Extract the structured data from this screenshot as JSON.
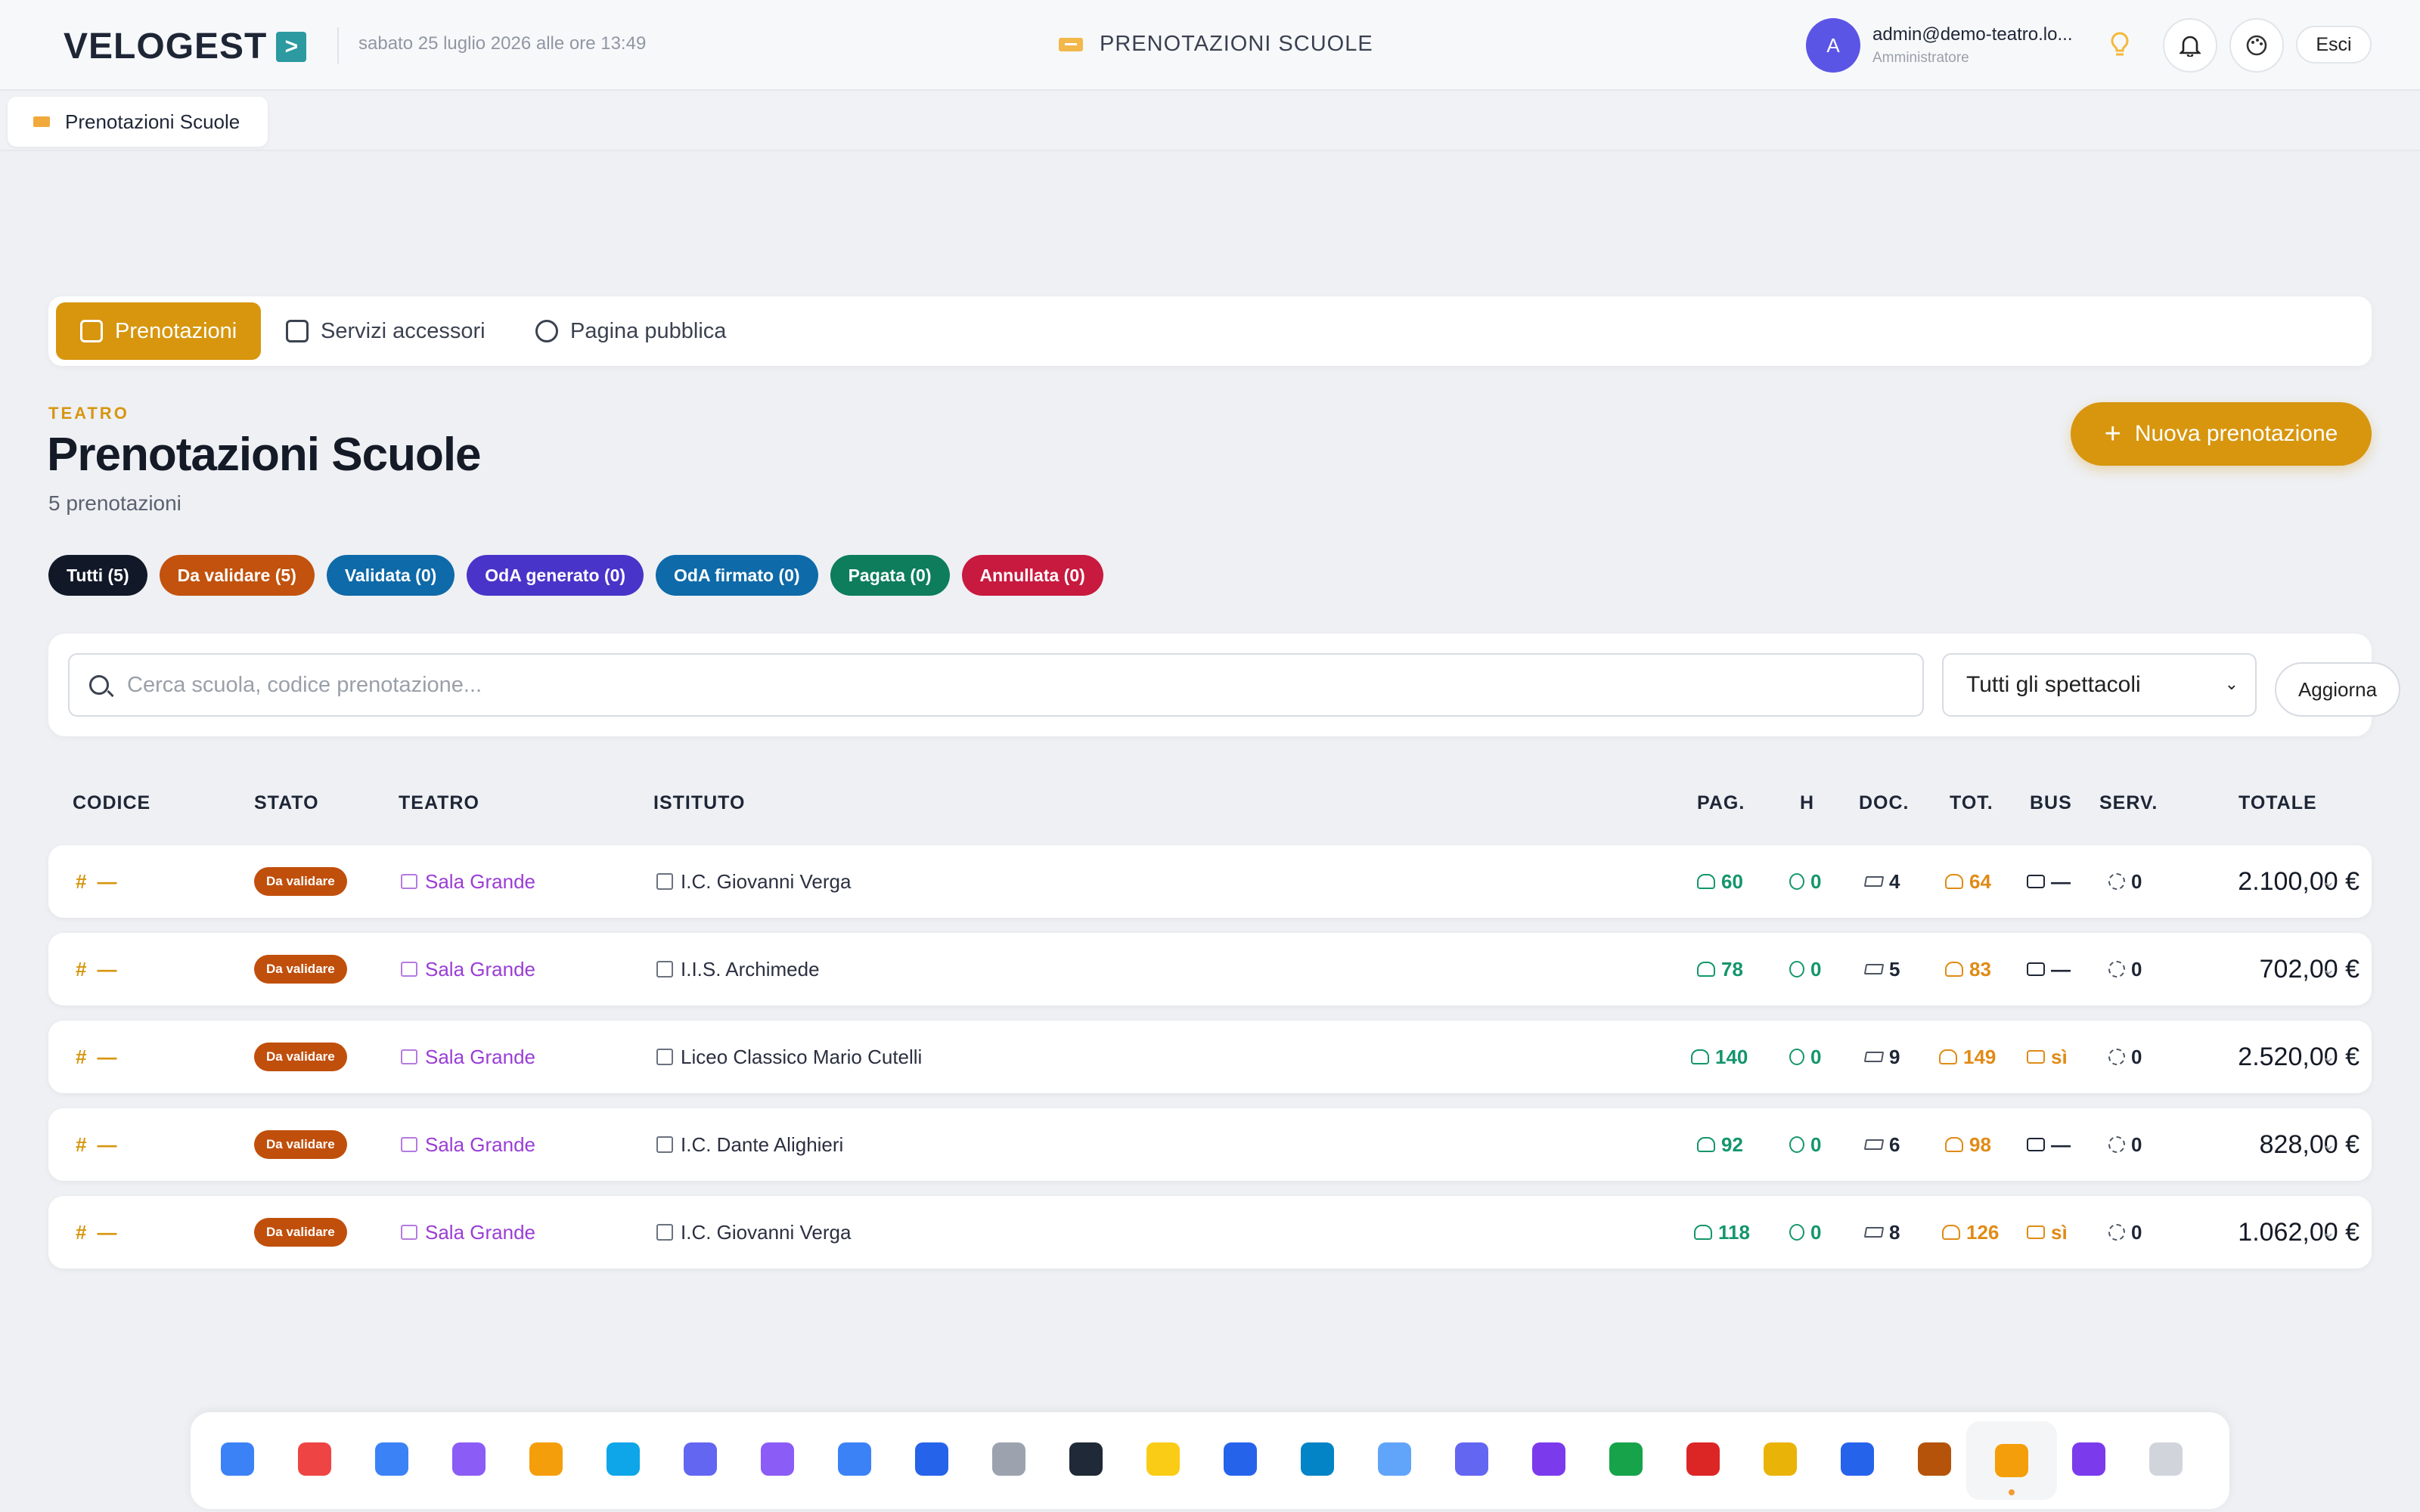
{
  "header": {
    "logo": "VELOGEST",
    "logo_mark": ">",
    "date": "sabato 25 luglio 2026 alle ore 13:49",
    "title": "PRENOTAZIONI SCUOLE",
    "user_initial": "A",
    "user_email": "admin@demo-teatro.lo...",
    "user_role": "Amministratore",
    "logout_label": "Esci",
    "icons": [
      "lightbulb-icon",
      "bell-icon",
      "palette-icon"
    ]
  },
  "page_tab": {
    "label": "Prenotazioni Scuole"
  },
  "tabs": [
    {
      "label": "Prenotazioni",
      "icon": "calendar-icon",
      "active": true
    },
    {
      "label": "Servizi accessori",
      "icon": "package-icon",
      "active": false
    },
    {
      "label": "Pagina pubblica",
      "icon": "globe-icon",
      "active": false
    }
  ],
  "section": {
    "kicker": "TEATRO",
    "title": "Prenotazioni Scuole",
    "count": "5 prenotazioni",
    "new_button": "Nuova prenotazione",
    "new_button_icon": "+"
  },
  "filters": [
    {
      "label": "Tutti (5)",
      "color": "#111827"
    },
    {
      "label": "Da validare (5)",
      "color": "#c2520d"
    },
    {
      "label": "Validata (0)",
      "color": "#0e6aa8"
    },
    {
      "label": "OdA generato (0)",
      "color": "#4834c9"
    },
    {
      "label": "OdA firmato (0)",
      "color": "#0e6aa8"
    },
    {
      "label": "Pagata (0)",
      "color": "#0d7d5c"
    },
    {
      "label": "Annullata (0)",
      "color": "#c8193f"
    }
  ],
  "search": {
    "placeholder": "Cerca scuola, codice prenotazione...",
    "select_value": "Tutti gli spettacoli",
    "select_caret": "⌄",
    "refresh_label": "Aggiorna"
  },
  "table": {
    "columns": [
      "CODICE",
      "STATO",
      "TEATRO",
      "ISTITUTO",
      "PAG.",
      "H",
      "DOC.",
      "TOT.",
      "BUS",
      "SERV.",
      "TOTALE"
    ],
    "rows": [
      {
        "hash": "#",
        "code": "—",
        "status": "Da validare",
        "theatre": "Sala Grande",
        "school": "I.C. Giovanni Verga",
        "pag": "60",
        "h": "0",
        "doc": "4",
        "tot": "64",
        "bus": "—",
        "serv": "0",
        "total": "2.100,00 €",
        "chevron": "⌄"
      },
      {
        "hash": "#",
        "code": "—",
        "status": "Da validare",
        "theatre": "Sala Grande",
        "school": "I.I.S. Archimede",
        "pag": "78",
        "h": "0",
        "doc": "5",
        "tot": "83",
        "bus": "—",
        "serv": "0",
        "total": "702,00 €",
        "chevron": "⌄"
      },
      {
        "hash": "#",
        "code": "—",
        "status": "Da validare",
        "theatre": "Sala Grande",
        "school": "Liceo Classico Mario Cutelli",
        "pag": "140",
        "h": "0",
        "doc": "9",
        "tot": "149",
        "bus": "sì",
        "serv": "0",
        "total": "2.520,00 €",
        "chevron": "⌄"
      },
      {
        "hash": "#",
        "code": "—",
        "status": "Da validare",
        "theatre": "Sala Grande",
        "school": "I.C. Dante Alighieri",
        "pag": "92",
        "h": "0",
        "doc": "6",
        "tot": "98",
        "bus": "—",
        "serv": "0",
        "total": "828,00 €",
        "chevron": "⌄"
      },
      {
        "hash": "#",
        "code": "—",
        "status": "Da validare",
        "theatre": "Sala Grande",
        "school": "I.C. Giovanni Verga",
        "pag": "118",
        "h": "0",
        "doc": "8",
        "tot": "126",
        "bus": "sì",
        "serv": "0",
        "total": "1.062,00 €",
        "chevron": "⌄"
      }
    ]
  },
  "dock": [
    {
      "icon": "apps-grid-icon",
      "color": "#3b82f6"
    },
    {
      "icon": "calendar-icon",
      "color": "#ef4444"
    },
    {
      "icon": "users-icon",
      "color": "#3b82f6"
    },
    {
      "icon": "network-icon",
      "color": "#8b5cf6"
    },
    {
      "icon": "package-icon",
      "color": "#f59e0b"
    },
    {
      "icon": "handshake-icon",
      "color": "#0ea5e9"
    },
    {
      "icon": "id-card-icon",
      "color": "#6366f1"
    },
    {
      "icon": "calculator-icon",
      "color": "#8b5cf6"
    },
    {
      "icon": "kanban-icon",
      "color": "#3b82f6"
    },
    {
      "icon": "headset-icon",
      "color": "#2563eb"
    },
    {
      "icon": "trash-icon",
      "color": "#9ca3af"
    },
    {
      "icon": "terminal-icon",
      "color": "#1f2937"
    },
    {
      "icon": "star-icon",
      "color": "#facc15"
    },
    {
      "icon": "building-icon",
      "color": "#2563eb"
    },
    {
      "icon": "globe-icon",
      "color": "#0284c7"
    },
    {
      "icon": "mail-icon",
      "color": "#60a5fa"
    },
    {
      "icon": "user-settings-icon",
      "color": "#6366f1"
    },
    {
      "icon": "video-icon",
      "color": "#7c3aed"
    },
    {
      "icon": "euro-ticket-icon",
      "color": "#16a34a"
    },
    {
      "icon": "shop-icon",
      "color": "#dc2626"
    },
    {
      "icon": "theatre-masks-icon",
      "color": "#eab308"
    },
    {
      "icon": "school-icon",
      "color": "#2563eb"
    },
    {
      "icon": "bank-icon",
      "color": "#b45309"
    },
    {
      "icon": "ticket-icon",
      "color": "#f59e0b",
      "active": true
    },
    {
      "icon": "home-icon",
      "color": "#7c3aed"
    },
    {
      "icon": "note-edit-icon",
      "color": "#d1d5db"
    }
  ]
}
